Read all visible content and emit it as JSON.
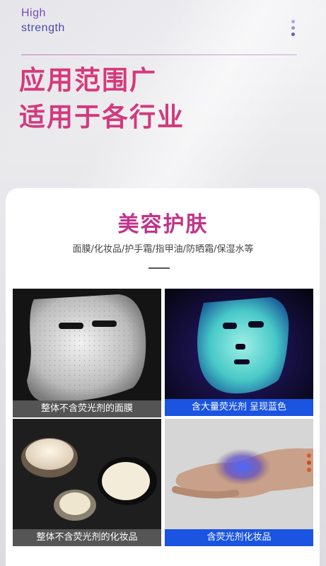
{
  "header": {
    "tag_line1": "High",
    "tag_line2": "strength",
    "headline_line1": "应用范围广",
    "headline_line2": "适用于各行业"
  },
  "section": {
    "title": "美容护肤",
    "subtitle": "面膜/化妆品/护手霜/指甲油/防晒霜/保湿水等"
  },
  "tiles": [
    {
      "caption": "整体不含荧光剂的面膜"
    },
    {
      "caption": "含大量荧光剂 呈现蓝色"
    },
    {
      "caption": "整体不含荧光剂的化妆品"
    },
    {
      "caption": "含荧光剂化妆品"
    }
  ],
  "colors": {
    "accent_pink": "#d6397a",
    "title_magenta": "#c0348a",
    "caption_blue": "#1a54e0",
    "caption_grey": "#5a5a5a"
  }
}
